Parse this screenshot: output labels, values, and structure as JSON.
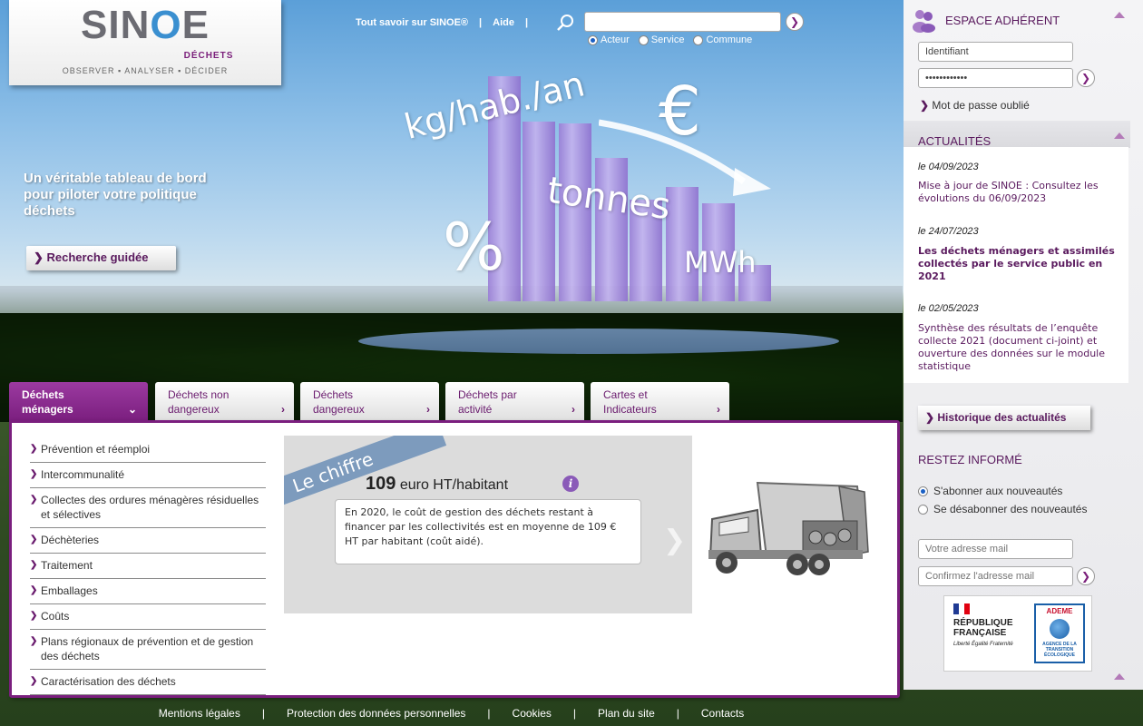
{
  "logo": {
    "name": "SINOE",
    "subtitle": "DÉCHETS",
    "tagline": "OBSERVER ▪ ANALYSER ▪ DÉCIDER"
  },
  "topnav": {
    "about": "Tout savoir sur SINOE®",
    "sep1": "|",
    "help": "Aide",
    "sep2": "|",
    "search_value": "",
    "radio_options": [
      "Acteur",
      "Service",
      "Commune"
    ],
    "radio_selected": "Acteur"
  },
  "hero": {
    "words": [
      "kg/hab./an",
      "€",
      "tonnes",
      "%",
      "MWh"
    ],
    "tagline": "Un véritable tableau de bord pour piloter votre politique déchets",
    "guided_search": "Recherche guidée"
  },
  "tabs": [
    {
      "label": "Déchets ménagers",
      "active": true
    },
    {
      "label": "Déchets non dangereux",
      "active": false
    },
    {
      "label": "Déchets dangereux",
      "active": false
    },
    {
      "label": "Déchets par activité",
      "active": false
    },
    {
      "label": "Cartes et Indicateurs",
      "active": false
    }
  ],
  "menu": [
    "Prévention et réemploi",
    "Intercommunalité",
    "Collectes des ordures ménagères résiduelles et sélectives",
    "Déchèteries",
    "Traitement",
    "Emballages",
    "Coûts",
    "Plans régionaux de prévention et de gestion des déchets",
    "Caractérisation des déchets"
  ],
  "chiffre": {
    "ribbon": "Le chiffre",
    "value_number": "109",
    "value_unit": "euro HT/habitant",
    "description": "En 2020, le coût de gestion des déchets restant à financer par les collectivités est en moyenne de 109 € HT par habitant (coût aidé)."
  },
  "footer": {
    "links": [
      "Mentions légales",
      "Protection des données personnelles",
      "Cookies",
      "Plan du site",
      "Contacts"
    ],
    "sep": "|"
  },
  "sidebar": {
    "member_title": "ESPACE ADHÉRENT",
    "login_value": "Identifiant",
    "password_value": "••••••••••••",
    "forgot": "Mot de passe oublié",
    "news_title": "ACTUALITÉS",
    "news": [
      {
        "date": "le 04/09/2023",
        "text": "Mise à jour de SINOE : Consultez les évolutions du 06/09/2023",
        "bold": false
      },
      {
        "date": "le 24/07/2023",
        "text": "Les déchets ménagers et assimilés collectés par le service public en 2021",
        "bold": true
      },
      {
        "date": "le 02/05/2023",
        "text": "Synthèse des résultats de l’enquête collecte 2021 (document ci-joint) et ouverture des données sur le module statistique",
        "bold": false
      }
    ],
    "history_btn": "Historique des actualités",
    "stay_title": "RESTEZ INFORMÉ",
    "subscribe": "S'abonner aux nouveautés",
    "unsubscribe": "Se désabonner des nouveautés",
    "email_placeholder": "Votre adresse mail",
    "confirm_placeholder": "Confirmez l'adresse mail",
    "rf_text": "RÉPUBLIQUE FRANÇAISE",
    "rf_motto": "Liberté Égalité Fraternité",
    "ademe_label": "ADEME",
    "ademe_sub": "AGENCE DE LA TRANSITION ÉCOLOGIQUE"
  },
  "colors": {
    "brand_purple": "#7a1e7e",
    "accent_blue": "#3a8fd0"
  }
}
